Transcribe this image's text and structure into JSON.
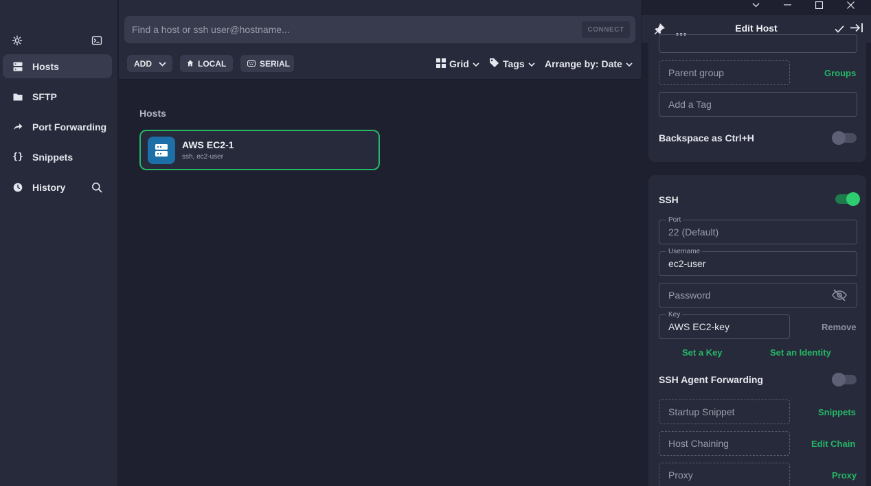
{
  "sidebar": {
    "items": [
      {
        "label": "Hosts",
        "icon": "hosts-icon"
      },
      {
        "label": "SFTP",
        "icon": "folder-icon"
      },
      {
        "label": "Port Forwarding",
        "icon": "port-forwarding-icon"
      },
      {
        "label": "Snippets",
        "icon": "snippets-icon"
      },
      {
        "label": "History",
        "icon": "history-icon"
      }
    ]
  },
  "search": {
    "placeholder": "Find a host or ssh user@hostname...",
    "connect_label": "CONNECT"
  },
  "toolbar": {
    "add_label": "ADD",
    "local_label": "LOCAL",
    "serial_label": "SERIAL",
    "view_label": "Grid",
    "tags_label": "Tags",
    "arrange_label": "Arrange by: Date"
  },
  "hosts": {
    "section_label": "Hosts",
    "items": [
      {
        "name": "AWS EC2-1",
        "sub": "ssh, ec2-user"
      }
    ]
  },
  "panel": {
    "title": "Edit Host",
    "parent_group": {
      "placeholder": "Parent group",
      "action": "Groups"
    },
    "tag": {
      "placeholder": "Add a Tag"
    },
    "backspace": {
      "label": "Backspace as Ctrl+H",
      "enabled": false
    },
    "ssh": {
      "label": "SSH",
      "enabled": true
    },
    "port": {
      "label": "Port",
      "placeholder": "22 (Default)"
    },
    "username": {
      "label": "Username",
      "value": "ec2-user"
    },
    "password": {
      "placeholder": "Password"
    },
    "key": {
      "label": "Key",
      "value": "AWS EC2-key",
      "remove": "Remove"
    },
    "set_key": "Set a Key",
    "set_identity": "Set an Identity",
    "agent_forwarding": {
      "label": "SSH Agent Forwarding",
      "enabled": false
    },
    "startup_snippet": {
      "placeholder": "Startup Snippet",
      "action": "Snippets"
    },
    "host_chaining": {
      "placeholder": "Host Chaining",
      "action": "Edit Chain"
    },
    "proxy": {
      "placeholder": "Proxy",
      "action": "Proxy"
    }
  },
  "colors": {
    "accent": "#25b667",
    "sidebar_bg": "#272a3a",
    "main_bg": "#1e2030",
    "host_icon_bg": "#1d6fa8"
  }
}
